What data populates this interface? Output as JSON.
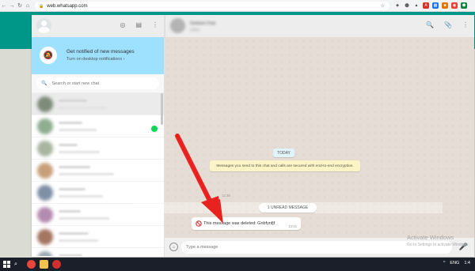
{
  "browser": {
    "nav": {
      "back": "←",
      "forward": "→",
      "reload": "↻",
      "home": "⌂"
    },
    "url": "web.whatsapp.com",
    "lock": "🔒",
    "star": "☆",
    "extensions": [
      {
        "name": "extension-1",
        "glyph": "◆",
        "color": "#5f6368"
      },
      {
        "name": "extension-2",
        "glyph": "⬤",
        "color": "#5f6368"
      },
      {
        "name": "extension-3",
        "glyph": "▲",
        "color": "#3c4043"
      },
      {
        "name": "extension-4",
        "glyph": "A",
        "color": "#d93025"
      },
      {
        "name": "extension-5",
        "glyph": "▦",
        "color": "#1a73e8"
      },
      {
        "name": "extension-6",
        "glyph": "■",
        "color": "#e37400"
      },
      {
        "name": "extension-7",
        "glyph": "◉",
        "color": "#ea4335"
      },
      {
        "name": "extension-8",
        "glyph": "⬢",
        "color": "#0b8043"
      }
    ]
  },
  "sidebar": {
    "tools": {
      "status": "◎",
      "new_chat": "▤",
      "menu": "⋮"
    },
    "notification": {
      "icon": "🔕",
      "title": "Get notified of new messages",
      "subtitle": "Turn on desktop notifications ›"
    },
    "search": {
      "icon": "🔍",
      "placeholder": "Search or start new chat"
    },
    "chats": [
      {
        "avatar_color": "#7d8b7a",
        "active": true,
        "unread": false
      },
      {
        "avatar_color": "#8fae90",
        "active": false,
        "unread": true
      },
      {
        "avatar_color": "#a8b5a0",
        "active": false,
        "unread": false
      },
      {
        "avatar_color": "#c7a07a",
        "active": false,
        "unread": false
      },
      {
        "avatar_color": "#7f8fa6",
        "active": false,
        "unread": false
      },
      {
        "avatar_color": "#b48bb0",
        "active": false,
        "unread": false
      },
      {
        "avatar_color": "#a47560",
        "active": false,
        "unread": false
      },
      {
        "avatar_color": "#9aa6b2",
        "active": false,
        "unread": false
      }
    ]
  },
  "conversation": {
    "contact": {
      "name": "Deleted Chat",
      "subtitle": "online"
    },
    "tools": {
      "search": "🔍",
      "attach": "📎",
      "menu": "⋮"
    },
    "day_label": "TODAY",
    "encryption_notice": "Messages you send to this chat and calls are secured with end-to-end encryption.",
    "notice_time": "12:38",
    "unread_label": "1 UNREAD MESSAGE",
    "message": {
      "text": "This message was deleted: Gnbfynfjf",
      "time": "13:41"
    },
    "composer": {
      "emoji_icon": "☺",
      "placeholder": "Type a message",
      "mic_icon": "🎤"
    }
  },
  "watermark": {
    "title": "Activate Windows",
    "subtitle": "Go to Settings to activate Windows."
  },
  "taskbar": {
    "search_icon": "⌕",
    "apps": [
      {
        "name": "chrome",
        "color": "#e8453c"
      },
      {
        "name": "file-explorer",
        "color": "#f2c14e"
      },
      {
        "name": "opera",
        "color": "#d32f2f"
      }
    ],
    "tray": {
      "chevron": "^",
      "lang": "ENG",
      "time": "1:4"
    }
  }
}
